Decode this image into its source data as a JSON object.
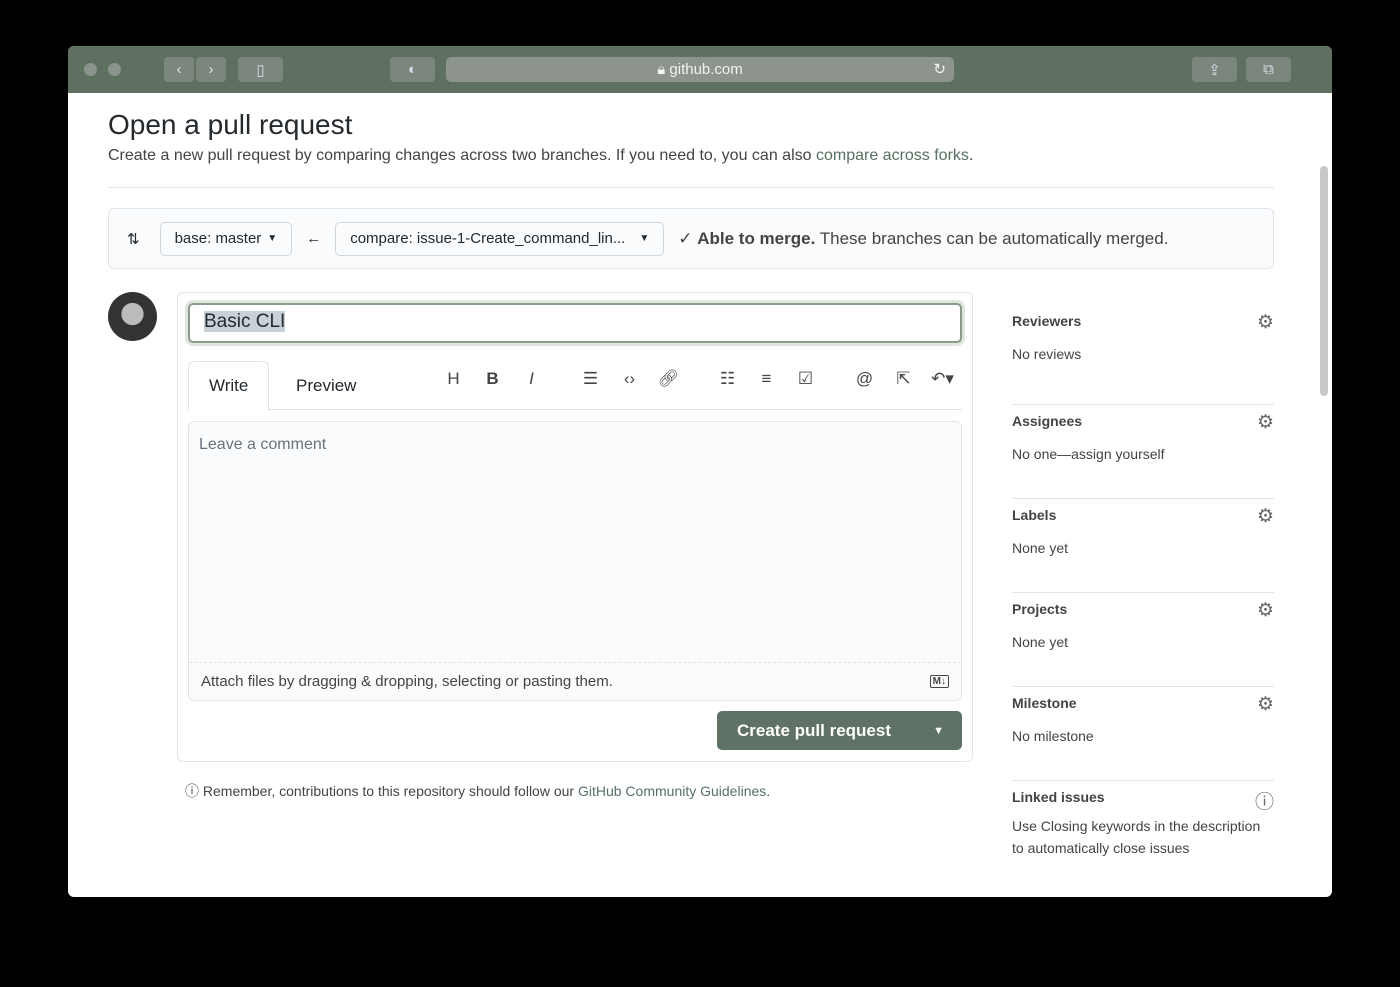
{
  "browser": {
    "url": "github.com"
  },
  "page": {
    "title": "Open a pull request",
    "subtitle": "Create a new pull request by comparing changes across two branches. If you need to, you can also ",
    "subtitle_link": "compare across forks",
    "subtitle_end": "."
  },
  "compare": {
    "base": "base: master",
    "compare": "compare: issue-1-Create_command_lin...",
    "merge_bold": "Able to merge.",
    "merge_text": "These branches can be automatically merged."
  },
  "form": {
    "title_value": "Basic CLI",
    "tabs": [
      "Write",
      "Preview"
    ],
    "placeholder": "Leave a comment",
    "attach": "Attach files by dragging & dropping, selecting or pasting them.",
    "markdown_badge": "M↓",
    "submit": "Create pull request"
  },
  "note": {
    "text": "Remember, contributions to this repository should follow our ",
    "link": "GitHub Community Guidelines",
    "end": "."
  },
  "sidebar": [
    {
      "heading": "Reviewers",
      "value": "No reviews"
    },
    {
      "heading": "Assignees",
      "value": "No one—assign yourself"
    },
    {
      "heading": "Labels",
      "value": "None yet"
    },
    {
      "heading": "Projects",
      "value": "None yet"
    },
    {
      "heading": "Milestone",
      "value": "No milestone"
    },
    {
      "heading": "Linked issues",
      "value": "Use Closing keywords in the description to automatically close issues"
    }
  ],
  "colors": {
    "toolbar": "#5f7060",
    "button": "#5f7265",
    "link": "#587062"
  }
}
